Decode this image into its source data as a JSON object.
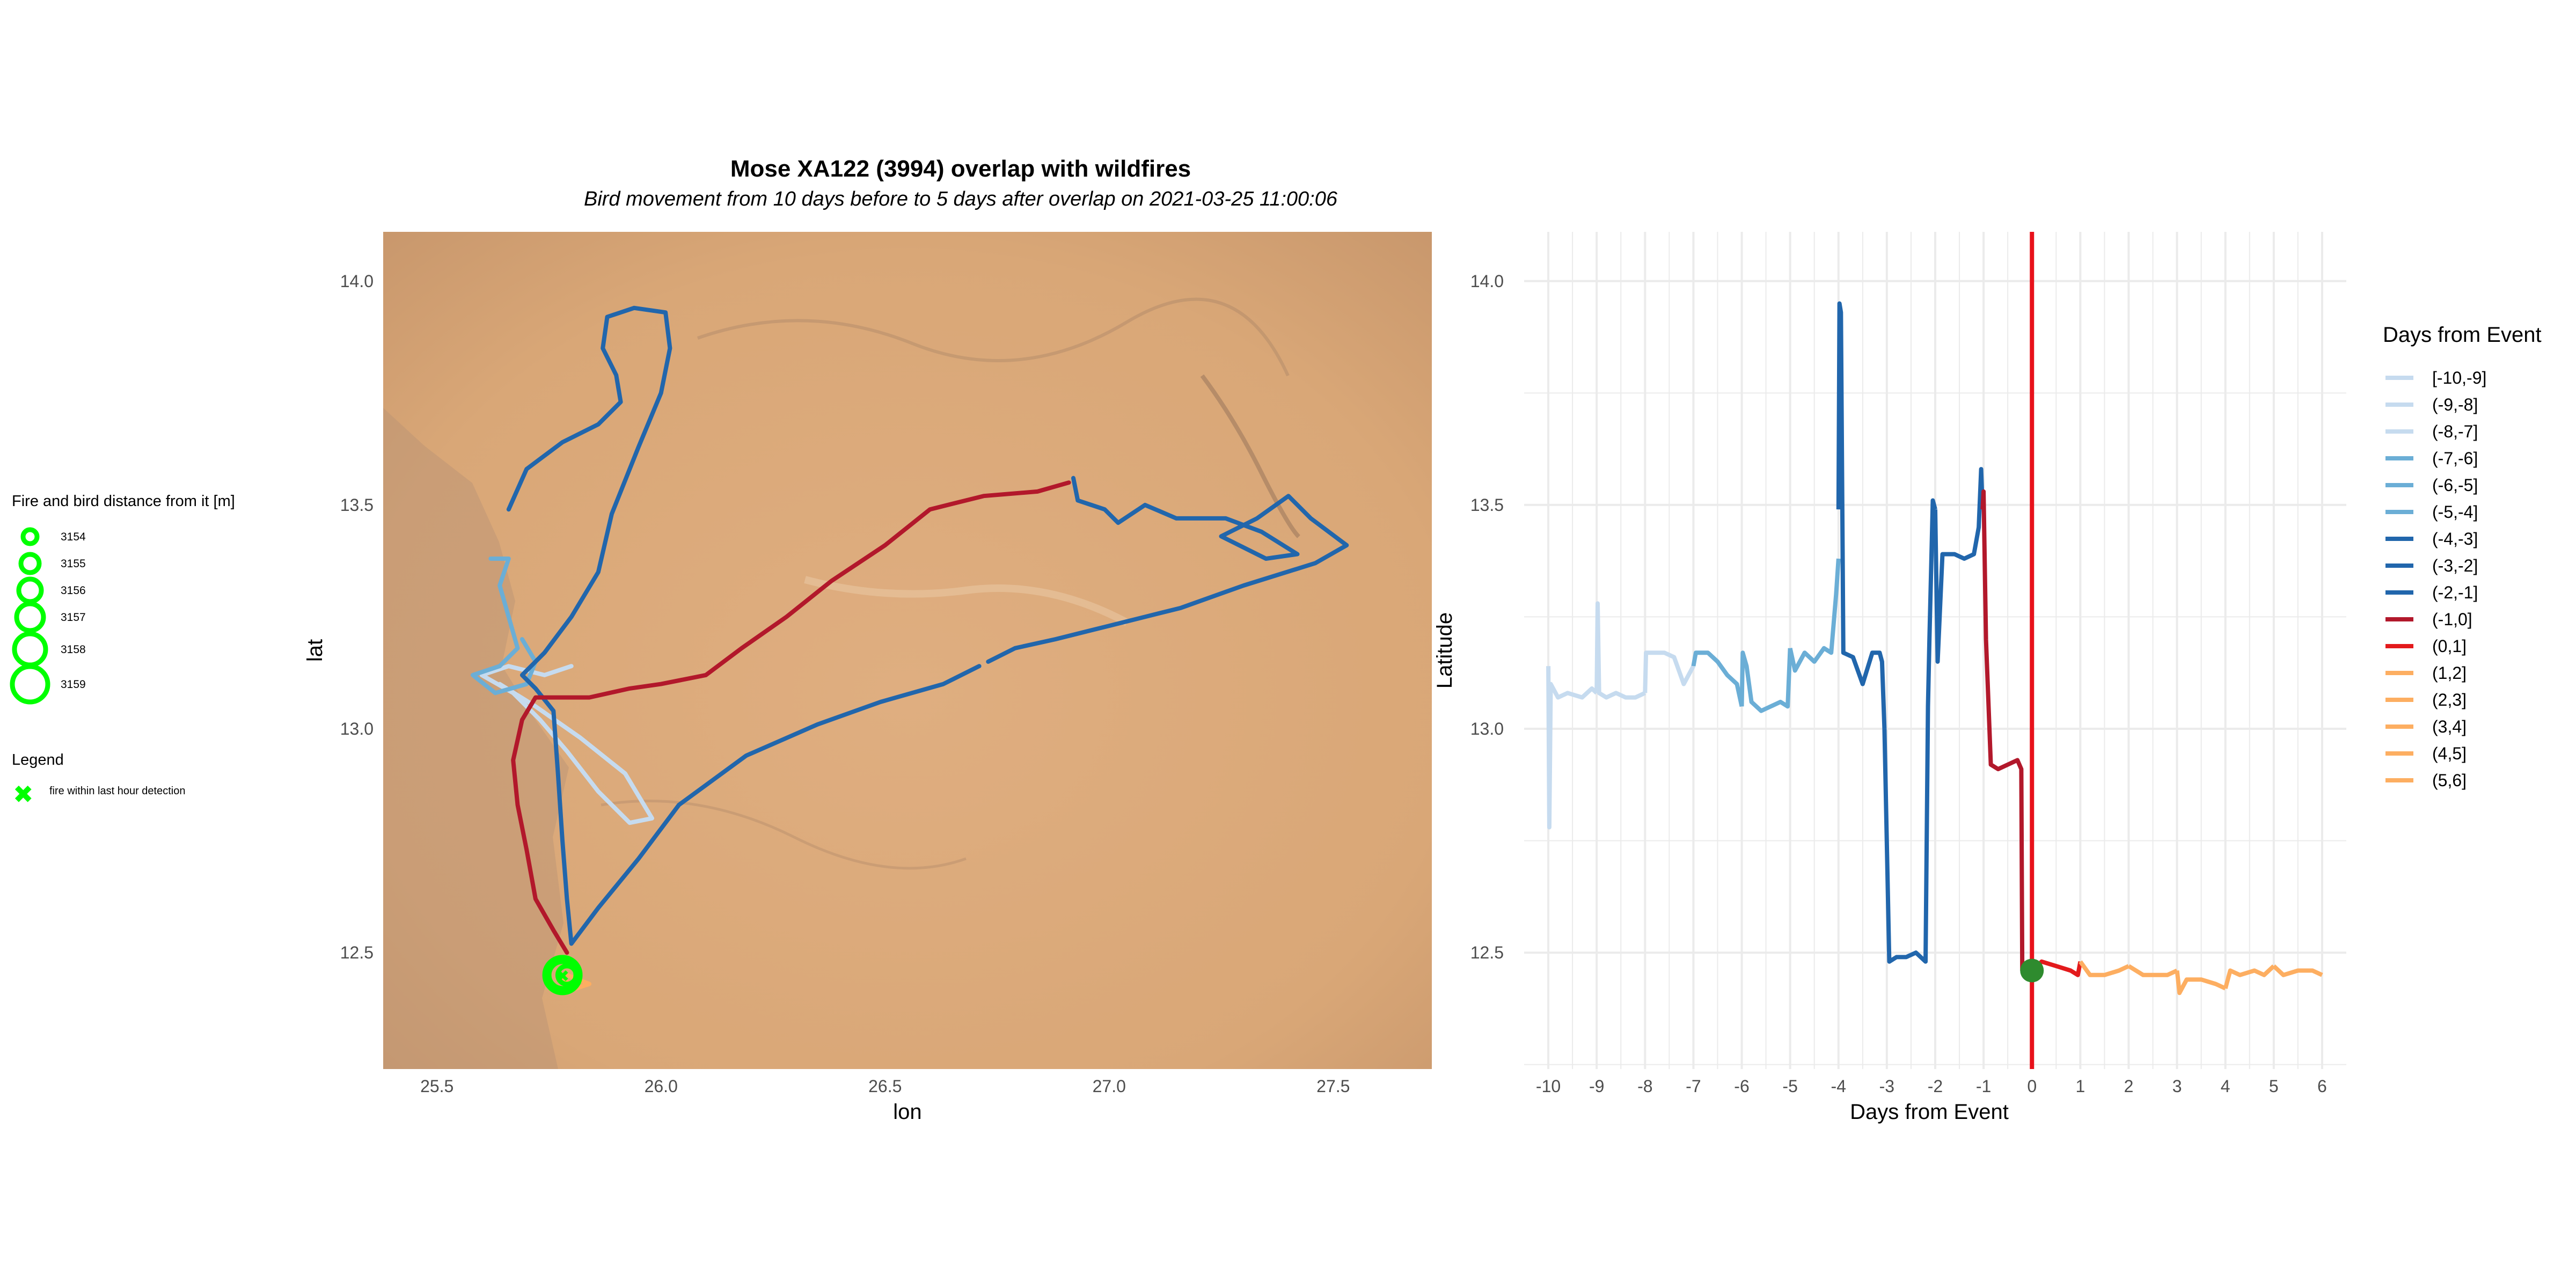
{
  "title": "Mose XA122 (3994) overlap with wildfires",
  "subtitle": "Bird movement from 10 days before to 5 days after overlap on 2021-03-25 11:00:06",
  "colors": {
    "map_bg": "#d9a777",
    "map_dark": "#8a6a55",
    "fire": "#00ff00",
    "event_line": "#e8121b",
    "event_marker": "#2e8b2e",
    "grid": "#ebebeb",
    "axis_text": "#4d4d4d"
  },
  "left_legends": {
    "distance": {
      "title": "Fire and bird distance from it [m]",
      "items": [
        "3154",
        "3155",
        "3156",
        "3157",
        "3158",
        "3159"
      ]
    },
    "fire": {
      "title": "Legend",
      "label": "fire within last hour detection",
      "icon": "green-x-icon"
    }
  },
  "chart_data": [
    {
      "type": "line",
      "title": "",
      "xlabel": "lon",
      "ylabel": "lat",
      "xlim": [
        25.38,
        27.72
      ],
      "ylim": [
        12.24,
        14.11
      ],
      "xticks": [
        "25.5",
        "26.0",
        "26.5",
        "27.0",
        "27.5"
      ],
      "yticks": [
        "12.5",
        "13.0",
        "13.5",
        "14.0"
      ],
      "series": [
        {
          "color": "#c6dbef",
          "points": [
            [
              25.64,
              13.1
            ],
            [
              25.72,
              13.05
            ],
            [
              25.82,
              12.98
            ],
            [
              25.92,
              12.9
            ],
            [
              25.98,
              12.8
            ],
            [
              25.93,
              12.79
            ],
            [
              25.86,
              12.86
            ],
            [
              25.79,
              12.95
            ],
            [
              25.73,
              13.02
            ],
            [
              25.67,
              13.08
            ],
            [
              25.6,
              13.12
            ],
            [
              25.66,
              13.14
            ],
            [
              25.74,
              13.12
            ],
            [
              25.8,
              13.14
            ]
          ]
        },
        {
          "color": "#6baed6",
          "points": [
            [
              25.62,
              13.38
            ],
            [
              25.66,
              13.38
            ],
            [
              25.64,
              13.32
            ],
            [
              25.66,
              13.25
            ],
            [
              25.68,
              13.18
            ],
            [
              25.64,
              13.14
            ],
            [
              25.58,
              13.12
            ],
            [
              25.63,
              13.08
            ],
            [
              25.7,
              13.1
            ],
            [
              25.72,
              13.15
            ],
            [
              25.69,
              13.2
            ]
          ]
        },
        {
          "color": "#2166ac",
          "points": [
            [
              25.66,
              13.49
            ],
            [
              25.7,
              13.58
            ],
            [
              25.78,
              13.64
            ],
            [
              25.86,
              13.68
            ],
            [
              25.91,
              13.73
            ],
            [
              25.9,
              13.79
            ],
            [
              25.87,
              13.85
            ],
            [
              25.88,
              13.92
            ],
            [
              25.94,
              13.94
            ],
            [
              26.01,
              13.93
            ],
            [
              26.02,
              13.85
            ],
            [
              26.0,
              13.75
            ],
            [
              25.95,
              13.63
            ],
            [
              25.89,
              13.48
            ],
            [
              25.86,
              13.35
            ],
            [
              25.8,
              13.25
            ],
            [
              25.74,
              13.17
            ],
            [
              25.69,
              13.12
            ],
            [
              25.72,
              13.09
            ],
            [
              25.76,
              13.04
            ],
            [
              25.77,
              12.9
            ],
            [
              25.78,
              12.75
            ],
            [
              25.79,
              12.62
            ],
            [
              25.8,
              12.52
            ],
            [
              25.86,
              12.6
            ],
            [
              25.95,
              12.71
            ],
            [
              26.04,
              12.83
            ],
            [
              26.19,
              12.94
            ],
            [
              26.35,
              13.01
            ],
            [
              26.49,
              13.06
            ],
            [
              26.63,
              13.1
            ],
            [
              26.71,
              13.14
            ]
          ]
        },
        {
          "color": "#2166ac",
          "points": [
            [
              26.73,
              13.15
            ],
            [
              26.79,
              13.18
            ],
            [
              26.88,
              13.2
            ],
            [
              27.0,
              13.23
            ],
            [
              27.16,
              13.27
            ],
            [
              27.3,
              13.32
            ],
            [
              27.46,
              13.37
            ],
            [
              27.53,
              13.41
            ],
            [
              27.45,
              13.47
            ],
            [
              27.4,
              13.52
            ],
            [
              27.33,
              13.47
            ],
            [
              27.25,
              13.43
            ],
            [
              27.35,
              13.38
            ],
            [
              27.42,
              13.39
            ],
            [
              27.34,
              13.44
            ],
            [
              27.26,
              13.47
            ],
            [
              27.15,
              13.47
            ],
            [
              27.08,
              13.5
            ],
            [
              27.02,
              13.46
            ],
            [
              26.99,
              13.49
            ],
            [
              26.93,
              13.51
            ],
            [
              26.92,
              13.56
            ]
          ]
        },
        {
          "color": "#b2182b",
          "points": [
            [
              25.79,
              12.5
            ],
            [
              25.76,
              12.55
            ],
            [
              25.72,
              12.62
            ],
            [
              25.7,
              12.73
            ],
            [
              25.68,
              12.83
            ],
            [
              25.67,
              12.93
            ],
            [
              25.69,
              13.02
            ],
            [
              25.72,
              13.07
            ],
            [
              25.84,
              13.07
            ],
            [
              25.93,
              13.09
            ],
            [
              26.0,
              13.1
            ],
            [
              26.1,
              13.12
            ],
            [
              26.18,
              13.18
            ],
            [
              26.28,
              13.25
            ],
            [
              26.38,
              13.33
            ],
            [
              26.5,
              13.41
            ],
            [
              26.6,
              13.49
            ],
            [
              26.72,
              13.52
            ],
            [
              26.84,
              13.53
            ],
            [
              26.91,
              13.55
            ]
          ]
        },
        {
          "color": "#fdae61",
          "points": [
            [
              25.78,
              12.44
            ],
            [
              25.81,
              12.42
            ],
            [
              25.84,
              12.43
            ],
            [
              25.79,
              12.45
            ]
          ]
        }
      ],
      "fire_circles": [
        {
          "lon": 25.78,
          "lat": 12.45,
          "distance_m": 3159
        },
        {
          "lon": 25.78,
          "lat": 12.45,
          "distance_m": 3157
        },
        {
          "lon": 25.79,
          "lat": 12.45,
          "distance_m": 3155
        }
      ]
    },
    {
      "type": "line",
      "title": "",
      "xlabel": "Days from Event",
      "ylabel": "Latitude",
      "xlim": [
        -10.5,
        6.5
      ],
      "ylim": [
        12.24,
        14.11
      ],
      "xticks": [
        "-10",
        "-9",
        "-8",
        "-7",
        "-6",
        "-5",
        "-4",
        "-3",
        "-2",
        "-1",
        "0",
        "1",
        "2",
        "3",
        "4",
        "5",
        "6"
      ],
      "yticks": [
        "12.5",
        "13.0",
        "13.5",
        "14.0"
      ],
      "event_x": 0,
      "legend_title": "Days from Event",
      "legend_position": "right",
      "series": [
        {
          "name": "[-10,-9]",
          "color": "#c6dbef",
          "points": [
            [
              -10,
              13.14
            ],
            [
              -9.98,
              12.78
            ],
            [
              -9.95,
              13.1
            ],
            [
              -9.8,
              13.07
            ],
            [
              -9.6,
              13.08
            ],
            [
              -9.3,
              13.07
            ],
            [
              -9.1,
              13.09
            ],
            [
              -9.0,
              13.08
            ]
          ]
        },
        {
          "name": "(-9,-8]",
          "color": "#c6dbef",
          "points": [
            [
              -9.0,
              13.08
            ],
            [
              -8.98,
              13.28
            ],
            [
              -8.95,
              13.08
            ],
            [
              -8.8,
              13.07
            ],
            [
              -8.6,
              13.08
            ],
            [
              -8.4,
              13.07
            ],
            [
              -8.2,
              13.07
            ],
            [
              -8.0,
              13.08
            ]
          ]
        },
        {
          "name": "(-8,-7]",
          "color": "#c6dbef",
          "points": [
            [
              -8.0,
              13.08
            ],
            [
              -7.98,
              13.17
            ],
            [
              -7.8,
              13.17
            ],
            [
              -7.6,
              13.17
            ],
            [
              -7.4,
              13.16
            ],
            [
              -7.2,
              13.1
            ],
            [
              -7.0,
              13.14
            ]
          ]
        },
        {
          "name": "(-7,-6]",
          "color": "#6baed6",
          "points": [
            [
              -7.0,
              13.14
            ],
            [
              -6.95,
              13.17
            ],
            [
              -6.7,
              13.17
            ],
            [
              -6.5,
              13.15
            ],
            [
              -6.3,
              13.12
            ],
            [
              -6.1,
              13.1
            ],
            [
              -6.0,
              13.05
            ]
          ]
        },
        {
          "name": "(-6,-5]",
          "color": "#6baed6",
          "points": [
            [
              -6.0,
              13.05
            ],
            [
              -5.98,
              13.17
            ],
            [
              -5.9,
              13.14
            ],
            [
              -5.8,
              13.06
            ],
            [
              -5.6,
              13.04
            ],
            [
              -5.4,
              13.05
            ],
            [
              -5.2,
              13.06
            ],
            [
              -5.05,
              13.05
            ],
            [
              -5.0,
              13.18
            ]
          ]
        },
        {
          "name": "(-5,-4]",
          "color": "#6baed6",
          "points": [
            [
              -5.0,
              13.18
            ],
            [
              -4.9,
              13.13
            ],
            [
              -4.7,
              13.17
            ],
            [
              -4.5,
              13.15
            ],
            [
              -4.3,
              13.18
            ],
            [
              -4.15,
              13.17
            ],
            [
              -4.05,
              13.3
            ],
            [
              -4.0,
              13.38
            ]
          ]
        },
        {
          "name": "(-4,-3]",
          "color": "#2166ac",
          "points": [
            [
              -4.0,
              13.49
            ],
            [
              -3.98,
              13.95
            ],
            [
              -3.95,
              13.93
            ],
            [
              -3.9,
              13.17
            ],
            [
              -3.7,
              13.16
            ],
            [
              -3.5,
              13.1
            ],
            [
              -3.3,
              13.17
            ],
            [
              -3.15,
              13.17
            ],
            [
              -3.1,
              13.15
            ],
            [
              -3.05,
              13.0
            ]
          ]
        },
        {
          "name": "(-3,-2]",
          "color": "#2166ac",
          "points": [
            [
              -3.05,
              13.0
            ],
            [
              -2.95,
              12.48
            ],
            [
              -2.8,
              12.49
            ],
            [
              -2.6,
              12.49
            ],
            [
              -2.4,
              12.5
            ],
            [
              -2.2,
              12.48
            ],
            [
              -2.15,
              13.05
            ],
            [
              -2.12,
              13.2
            ],
            [
              -2.05,
              13.51
            ],
            [
              -2.0,
              13.49
            ]
          ]
        },
        {
          "name": "(-2,-1]",
          "color": "#2166ac",
          "points": [
            [
              -2.0,
              13.49
            ],
            [
              -1.95,
              13.15
            ],
            [
              -1.85,
              13.39
            ],
            [
              -1.6,
              13.39
            ],
            [
              -1.4,
              13.38
            ],
            [
              -1.2,
              13.39
            ],
            [
              -1.15,
              13.42
            ],
            [
              -1.1,
              13.45
            ],
            [
              -1.05,
              13.58
            ],
            [
              -1.02,
              13.49
            ]
          ]
        },
        {
          "name": "(-1,0]",
          "color": "#b2182b",
          "points": [
            [
              -1.02,
              13.49
            ],
            [
              -1.0,
              13.53
            ],
            [
              -0.95,
              13.2
            ],
            [
              -0.9,
              13.06
            ],
            [
              -0.85,
              12.92
            ],
            [
              -0.7,
              12.91
            ],
            [
              -0.5,
              12.92
            ],
            [
              -0.3,
              12.93
            ],
            [
              -0.22,
              12.91
            ],
            [
              -0.2,
              12.46
            ]
          ]
        },
        {
          "name": "(0,1]",
          "color": "#e31a1c",
          "points": [
            [
              0.0,
              12.46
            ],
            [
              0.2,
              12.48
            ],
            [
              0.5,
              12.47
            ],
            [
              0.8,
              12.46
            ],
            [
              0.95,
              12.45
            ],
            [
              1.0,
              12.48
            ]
          ]
        },
        {
          "name": "(1,2]",
          "color": "#fdae61",
          "points": [
            [
              1.0,
              12.48
            ],
            [
              1.2,
              12.45
            ],
            [
              1.5,
              12.45
            ],
            [
              1.8,
              12.46
            ],
            [
              2.0,
              12.47
            ]
          ]
        },
        {
          "name": "(2,3]",
          "color": "#fdae61",
          "points": [
            [
              2.0,
              12.47
            ],
            [
              2.3,
              12.45
            ],
            [
              2.6,
              12.45
            ],
            [
              2.8,
              12.45
            ],
            [
              3.0,
              12.46
            ]
          ]
        },
        {
          "name": "(3,4]",
          "color": "#fdae61",
          "points": [
            [
              3.0,
              12.46
            ],
            [
              3.05,
              12.41
            ],
            [
              3.2,
              12.44
            ],
            [
              3.5,
              12.44
            ],
            [
              3.8,
              12.43
            ],
            [
              4.0,
              12.42
            ]
          ]
        },
        {
          "name": "(4,5]",
          "color": "#fdae61",
          "points": [
            [
              4.0,
              12.42
            ],
            [
              4.1,
              12.46
            ],
            [
              4.3,
              12.45
            ],
            [
              4.6,
              12.46
            ],
            [
              4.8,
              12.45
            ],
            [
              5.0,
              12.47
            ]
          ]
        },
        {
          "name": "(5,6]",
          "color": "#fdae61",
          "points": [
            [
              5.0,
              12.47
            ],
            [
              5.2,
              12.45
            ],
            [
              5.5,
              12.46
            ],
            [
              5.8,
              12.46
            ],
            [
              6.0,
              12.45
            ]
          ]
        }
      ],
      "event_marker": {
        "x": 0.0,
        "y": 12.46
      }
    }
  ]
}
